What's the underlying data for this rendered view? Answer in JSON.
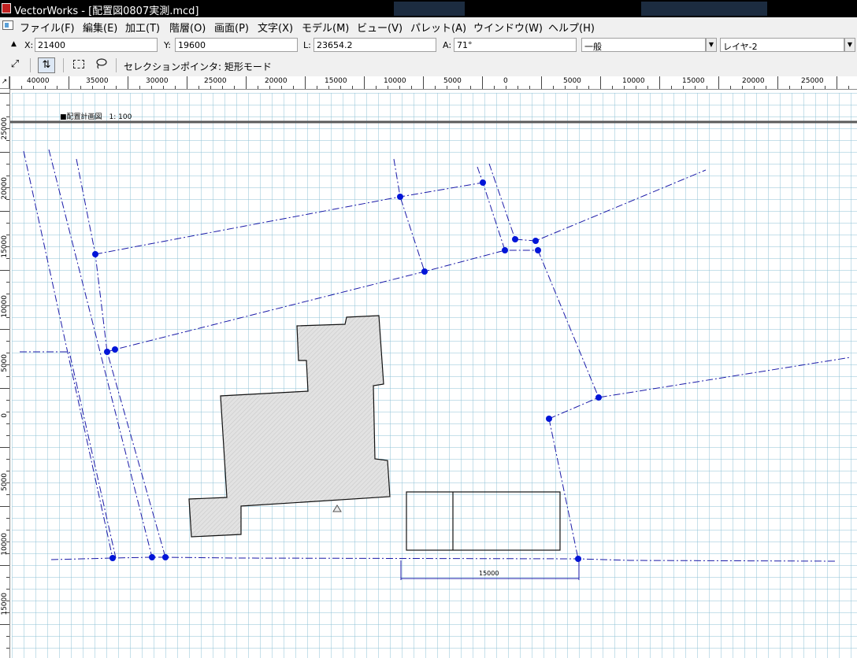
{
  "window": {
    "title": "VectorWorks - [配置図0807実測.mcd]"
  },
  "menu": {
    "items": [
      "ファイル(F)",
      "編集(E)",
      "加工(T)",
      "階層(O)",
      "画面(P)",
      "文字(X)",
      "モデル(M)",
      "ビュー(V)",
      "パレット(A)",
      "ウインドウ(W)",
      "ヘルプ(H)"
    ]
  },
  "data_display": {
    "x_label": "X:",
    "x_value": "21400",
    "y_label": "Y:",
    "y_value": "19600",
    "l_label": "L:",
    "l_value": "23654.2",
    "a_label": "A:",
    "a_value": "71°",
    "class_value": "一般",
    "layer_value": "レイヤ-2"
  },
  "mode_bar": {
    "text": "セレクションポインタ: 矩形モード"
  },
  "rulers": {
    "horizontal": [
      "40000",
      "35000",
      "30000",
      "25000",
      "20000",
      "15000",
      "10000",
      "5000",
      "0",
      "5000",
      "10000",
      "15000",
      "20000",
      "25000"
    ],
    "vertical": [
      "25000",
      "20000",
      "15000",
      "10000",
      "5000",
      "0",
      "5000",
      "10000",
      "15000"
    ]
  },
  "drawing": {
    "sheet_title": "■配置計画図　1: 100",
    "dimension_label": "15000",
    "colors": {
      "grid": "#7fb5cc",
      "survey_line": "#1a1aa8",
      "node": "#0015d8",
      "building_fill": "#e2e2e2"
    }
  }
}
